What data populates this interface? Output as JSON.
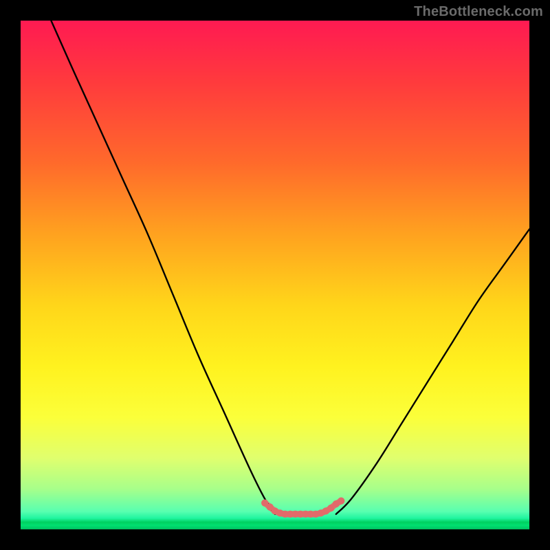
{
  "watermark": "TheBottleneck.com",
  "chart_data": {
    "type": "line",
    "title": "",
    "xlabel": "",
    "ylabel": "",
    "xlim": [
      0,
      100
    ],
    "ylim": [
      0,
      100
    ],
    "series": [
      {
        "name": "left-curve",
        "x": [
          6,
          10,
          15,
          20,
          25,
          30,
          35,
          40,
          45,
          48,
          50
        ],
        "y": [
          100,
          91,
          80,
          69,
          58,
          46,
          34,
          23,
          12,
          6,
          3
        ]
      },
      {
        "name": "right-curve",
        "x": [
          62,
          65,
          70,
          75,
          80,
          85,
          90,
          95,
          100
        ],
        "y": [
          3,
          6,
          13,
          21,
          29,
          37,
          45,
          52,
          59
        ]
      },
      {
        "name": "valley-floor",
        "x": [
          48,
          49,
          50,
          51,
          52,
          53,
          54,
          55,
          56,
          57,
          58,
          59,
          60,
          61,
          62,
          63
        ],
        "y": [
          5.2,
          4.4,
          3.6,
          3.2,
          3.0,
          3.0,
          3.0,
          3.0,
          3.0,
          3.0,
          3.0,
          3.2,
          3.6,
          4.2,
          5.0,
          5.6
        ]
      }
    ],
    "gradient_stops": [
      {
        "pos": 0,
        "color": "#ff1a52"
      },
      {
        "pos": 0.12,
        "color": "#ff3a3d"
      },
      {
        "pos": 0.28,
        "color": "#ff6a2b"
      },
      {
        "pos": 0.42,
        "color": "#ffa21f"
      },
      {
        "pos": 0.56,
        "color": "#ffd61a"
      },
      {
        "pos": 0.68,
        "color": "#fff21f"
      },
      {
        "pos": 0.78,
        "color": "#fbff3a"
      },
      {
        "pos": 0.86,
        "color": "#e0ff6e"
      },
      {
        "pos": 0.92,
        "color": "#a8ff8a"
      },
      {
        "pos": 0.965,
        "color": "#58ffb0"
      },
      {
        "pos": 0.986,
        "color": "#00d060"
      },
      {
        "pos": 1.0,
        "color": "#00c060"
      }
    ],
    "valley_color": "#e26a6a",
    "curve_color": "#000000"
  }
}
